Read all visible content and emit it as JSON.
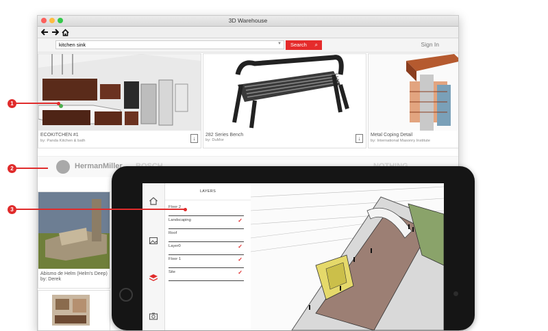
{
  "window": {
    "title": "3D Warehouse"
  },
  "search": {
    "value": "kitchen sink",
    "button": "Search",
    "signin": "Sign In"
  },
  "models": [
    {
      "title": "ECOKITCHEN #1",
      "author": "by: Panda Kitchen & bath"
    },
    {
      "title": "282 Series Bench",
      "author": "by: DuMor"
    },
    {
      "title": "Metal Coping Detail",
      "author": "by: International Masonry Institute"
    }
  ],
  "brands": [
    "HermanMiller",
    "BOSCH",
    "NOTHING"
  ],
  "model2": {
    "title": "Abismo de Helm (Helm's Deep)",
    "author": "by: Derek"
  },
  "panel": {
    "title": "LAYERS",
    "layers": [
      {
        "name": "Floor 2",
        "checked": false
      },
      {
        "name": "Landscaping",
        "checked": true
      },
      {
        "name": "Roof",
        "checked": false
      },
      {
        "name": "Layer0",
        "checked": true
      },
      {
        "name": "Floor 1",
        "checked": true
      },
      {
        "name": "Site",
        "checked": true
      }
    ]
  },
  "callouts": [
    "1",
    "2",
    "3"
  ],
  "icons": {
    "back": "back-arrow-icon",
    "forward": "forward-arrow-icon",
    "home": "home-icon",
    "search": "magnifier-icon",
    "download": "download-icon",
    "layers": "layers-icon",
    "camera": "camera-icon",
    "image": "image-icon",
    "check": "checkmark-icon"
  },
  "colors": {
    "accent": "#e52b2b",
    "check": "#e02b2b"
  }
}
